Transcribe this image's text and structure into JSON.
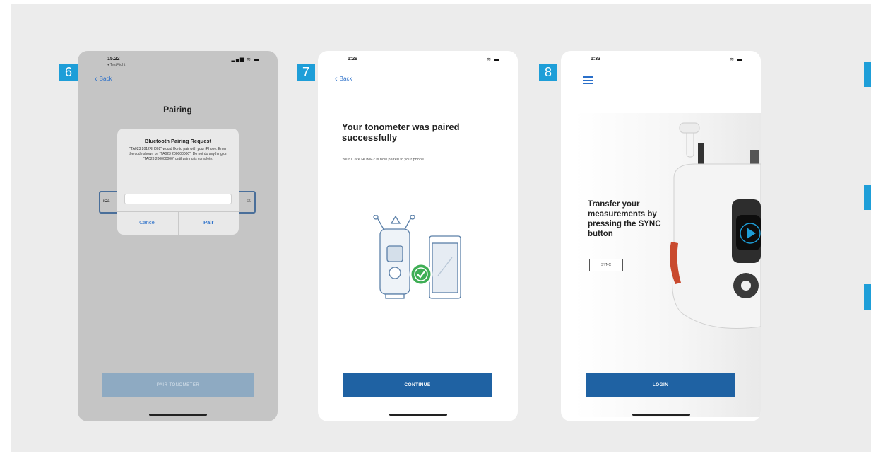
{
  "steps": [
    "6",
    "7",
    "8"
  ],
  "phone6": {
    "status_time": "15.22",
    "status_sub": "◂ TestFlight",
    "status_right": "▂▄▆ ≋ ▬",
    "back": "Back",
    "title": "Pairing",
    "field_left": "iCa",
    "field_right": "00",
    "dialog_title": "Bluetooth Pairing Request",
    "dialog_msg": "\"TA023 2012RH002\" would like to pair with your iPhone. Enter the code shown on \"TA023 200000000\". Do not do anything on \"TA023 200000000\" until pairing is complete.",
    "cancel": "Cancel",
    "pair": "Pair",
    "button": "PAIR TONOMETER"
  },
  "phone7": {
    "status_time": "1:29",
    "status_right": "≋ ▬",
    "back": "Back",
    "title": "Your tonometer was paired successfully",
    "subtitle": "Your iCare HOME2 is now paired to your phone.",
    "button": "CONTINUE"
  },
  "phone8": {
    "status_time": "1:33",
    "status_right": "≋ ▬",
    "title": "Transfer your measurements by pressing the SYNC button",
    "sync": "SYNC",
    "button": "LOGIN"
  },
  "colors": {
    "accent": "#1e9ed8",
    "primary_button": "#1f62a3",
    "disabled_button": "#8eaac2",
    "link": "#2a6fc9"
  }
}
